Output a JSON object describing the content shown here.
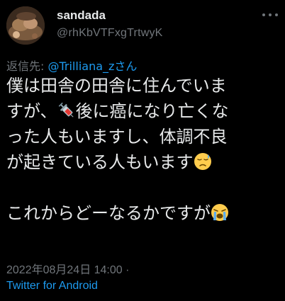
{
  "author": {
    "display_name": "sandada",
    "handle": "@rhKbVTFxgTrtwyK"
  },
  "reply": {
    "prefix": "返信先: ",
    "mention": "@Trilliana_zさん"
  },
  "body": {
    "line1": "僕は田舎の田舎に住んでいま",
    "line2_a": "すが、",
    "line2_emoji": "syringe-emoji",
    "line2_b": "後に癌になり亡くな",
    "line3": "った人もいますし、体調不良",
    "line4_a": "が起きている人もいます",
    "line4_emoji": "sad-relieved-face-emoji",
    "line6_a": "これからどーなるかですが",
    "line6_emoji": "loudly-crying-face-emoji"
  },
  "meta": {
    "timestamp": "2022年08月24日 14:00 ·",
    "source": "Twitter for Android"
  },
  "colors": {
    "background": "#000000",
    "text": "#e7e9ea",
    "muted": "#71767b",
    "link": "#1d9bf0"
  }
}
